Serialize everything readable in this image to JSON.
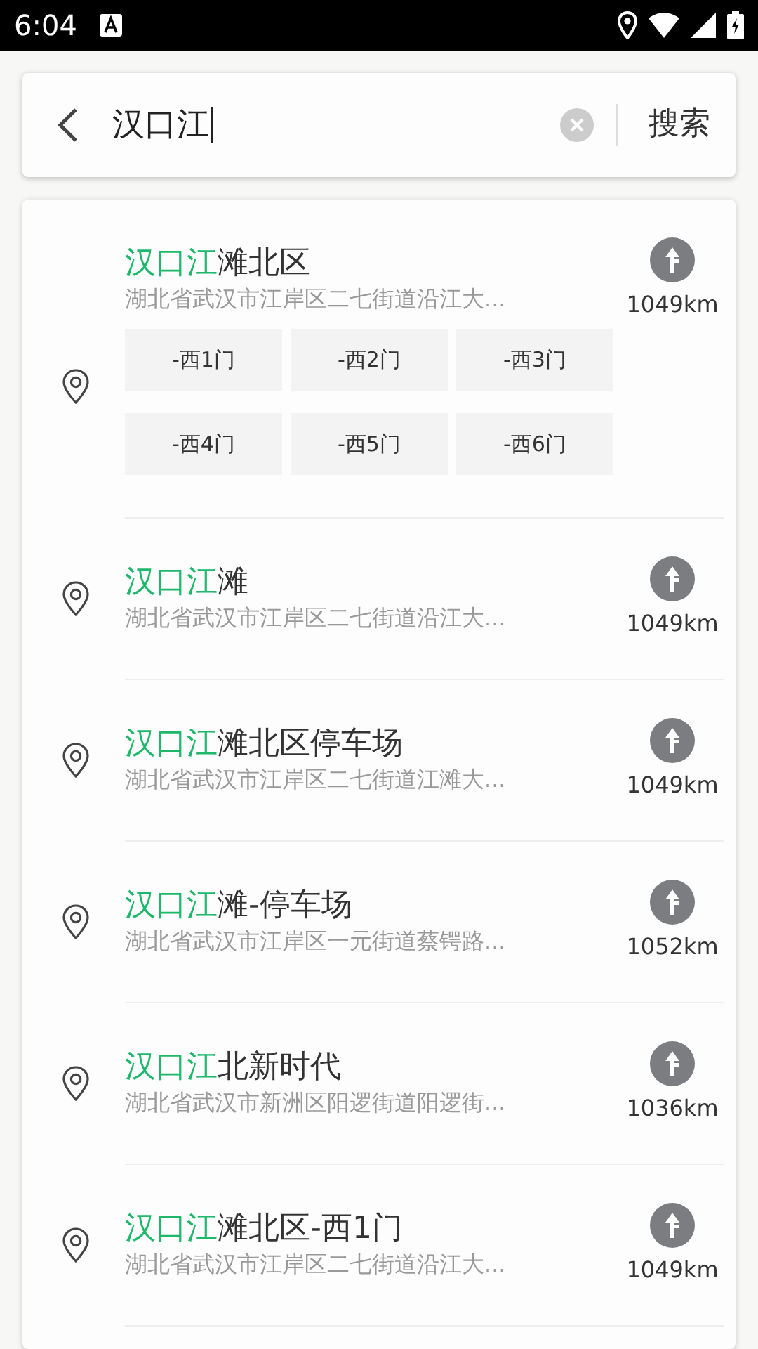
{
  "status_bar": {
    "time": "6:04"
  },
  "search": {
    "query": "汉口江",
    "button": "搜索"
  },
  "results": [
    {
      "title": {
        "match": "汉口江",
        "rest": "滩北区"
      },
      "address": "湖北省武汉市江岸区二七街道沿江大...",
      "distance": "1049km",
      "sub_pois": [
        "-西1门",
        "-西2门",
        "-西3门",
        "-西4门",
        "-西5门",
        "-西6门"
      ]
    },
    {
      "title": {
        "match": "汉口江",
        "rest": "滩"
      },
      "address": "湖北省武汉市江岸区二七街道沿江大...",
      "distance": "1049km"
    },
    {
      "title": {
        "match": "汉口江",
        "rest": "滩北区停车场"
      },
      "address": "湖北省武汉市江岸区二七街道江滩大...",
      "distance": "1049km"
    },
    {
      "title": {
        "match": "汉口江",
        "rest": "滩-停车场"
      },
      "address": "湖北省武汉市江岸区一元街道蔡锷路...",
      "distance": "1052km"
    },
    {
      "title": {
        "match": "汉口江",
        "rest": "北新时代"
      },
      "address": "湖北省武汉市新洲区阳逻街道阳逻街...",
      "distance": "1036km"
    },
    {
      "title": {
        "match": "汉口江",
        "rest": "滩北区-西1门"
      },
      "address": "湖北省武汉市江岸区二七街道沿江大...",
      "distance": "1049km"
    }
  ]
}
